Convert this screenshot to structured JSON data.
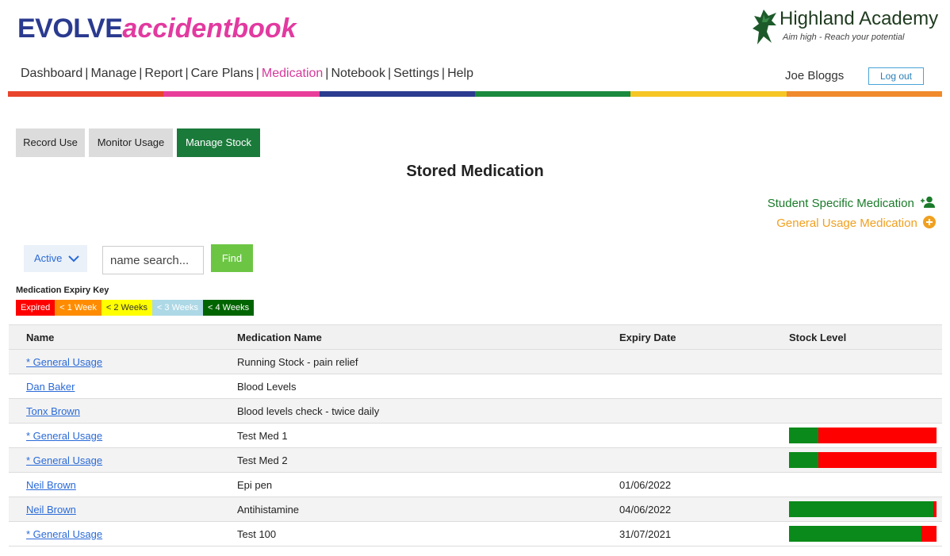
{
  "brand": {
    "part1": "EVOLVE",
    "part2": "accidentbook"
  },
  "school": {
    "name": "Highland Academy",
    "motto": "Aim high - Reach your potential"
  },
  "nav": {
    "items": [
      {
        "label": "Dashboard",
        "active": false
      },
      {
        "label": "Manage",
        "active": false
      },
      {
        "label": "Report",
        "active": false
      },
      {
        "label": "Care Plans",
        "active": false
      },
      {
        "label": "Medication",
        "active": true
      },
      {
        "label": "Notebook",
        "active": false
      },
      {
        "label": "Settings",
        "active": false
      },
      {
        "label": "Help",
        "active": false
      }
    ],
    "separator": "|"
  },
  "user": {
    "name": "Joe Bloggs",
    "logout_label": "Log out"
  },
  "colorbar": [
    "#e8452c",
    "#e83e9a",
    "#2b3b8f",
    "#1a8a3e",
    "#f6c624",
    "#f08a2c"
  ],
  "tabs": {
    "record": "Record Use",
    "monitor": "Monitor Usage",
    "stock": "Manage Stock"
  },
  "page_title": "Stored Medication",
  "links": {
    "student": "Student Specific Medication",
    "general": "General Usage Medication"
  },
  "filter": {
    "status": "Active",
    "search_placeholder": "name search...",
    "find_label": "Find"
  },
  "expiry_key": {
    "label": "Medication Expiry Key",
    "items": [
      {
        "label": "Expired",
        "bg": "#ff0000",
        "fg": "#ffffff"
      },
      {
        "label": "< 1 Week",
        "bg": "#ff8c00",
        "fg": "#ffffff"
      },
      {
        "label": "< 2 Weeks",
        "bg": "#ffff00",
        "fg": "#333333"
      },
      {
        "label": "< 3 Weeks",
        "bg": "#add8e6",
        "fg": "#ffffff"
      },
      {
        "label": "< 4 Weeks",
        "bg": "#006400",
        "fg": "#ffffff"
      }
    ]
  },
  "table": {
    "headers": [
      "Name",
      "Medication Name",
      "Expiry Date",
      "Stock Level"
    ],
    "rows": [
      {
        "name": "* General Usage",
        "medication": "Running Stock - pain relief",
        "expiry": "",
        "stock_fraction": null
      },
      {
        "name": "Dan Baker",
        "medication": "Blood Levels",
        "expiry": "",
        "stock_fraction": null
      },
      {
        "name": "Tonx Brown",
        "medication": "Blood levels check - twice daily",
        "expiry": "",
        "stock_fraction": null
      },
      {
        "name": "* General Usage",
        "medication": "Test Med 1",
        "expiry": "",
        "stock_fraction": 0.2
      },
      {
        "name": "* General Usage",
        "medication": "Test Med 2",
        "expiry": "",
        "stock_fraction": 0.2
      },
      {
        "name": "Neil Brown",
        "medication": "Epi pen",
        "expiry": "01/06/2022",
        "stock_fraction": null
      },
      {
        "name": "Neil Brown",
        "medication": "Antihistamine",
        "expiry": "04/06/2022",
        "stock_fraction": 0.98
      },
      {
        "name": "* General Usage",
        "medication": "Test 100",
        "expiry": "31/07/2021",
        "stock_fraction": 0.9
      }
    ]
  }
}
